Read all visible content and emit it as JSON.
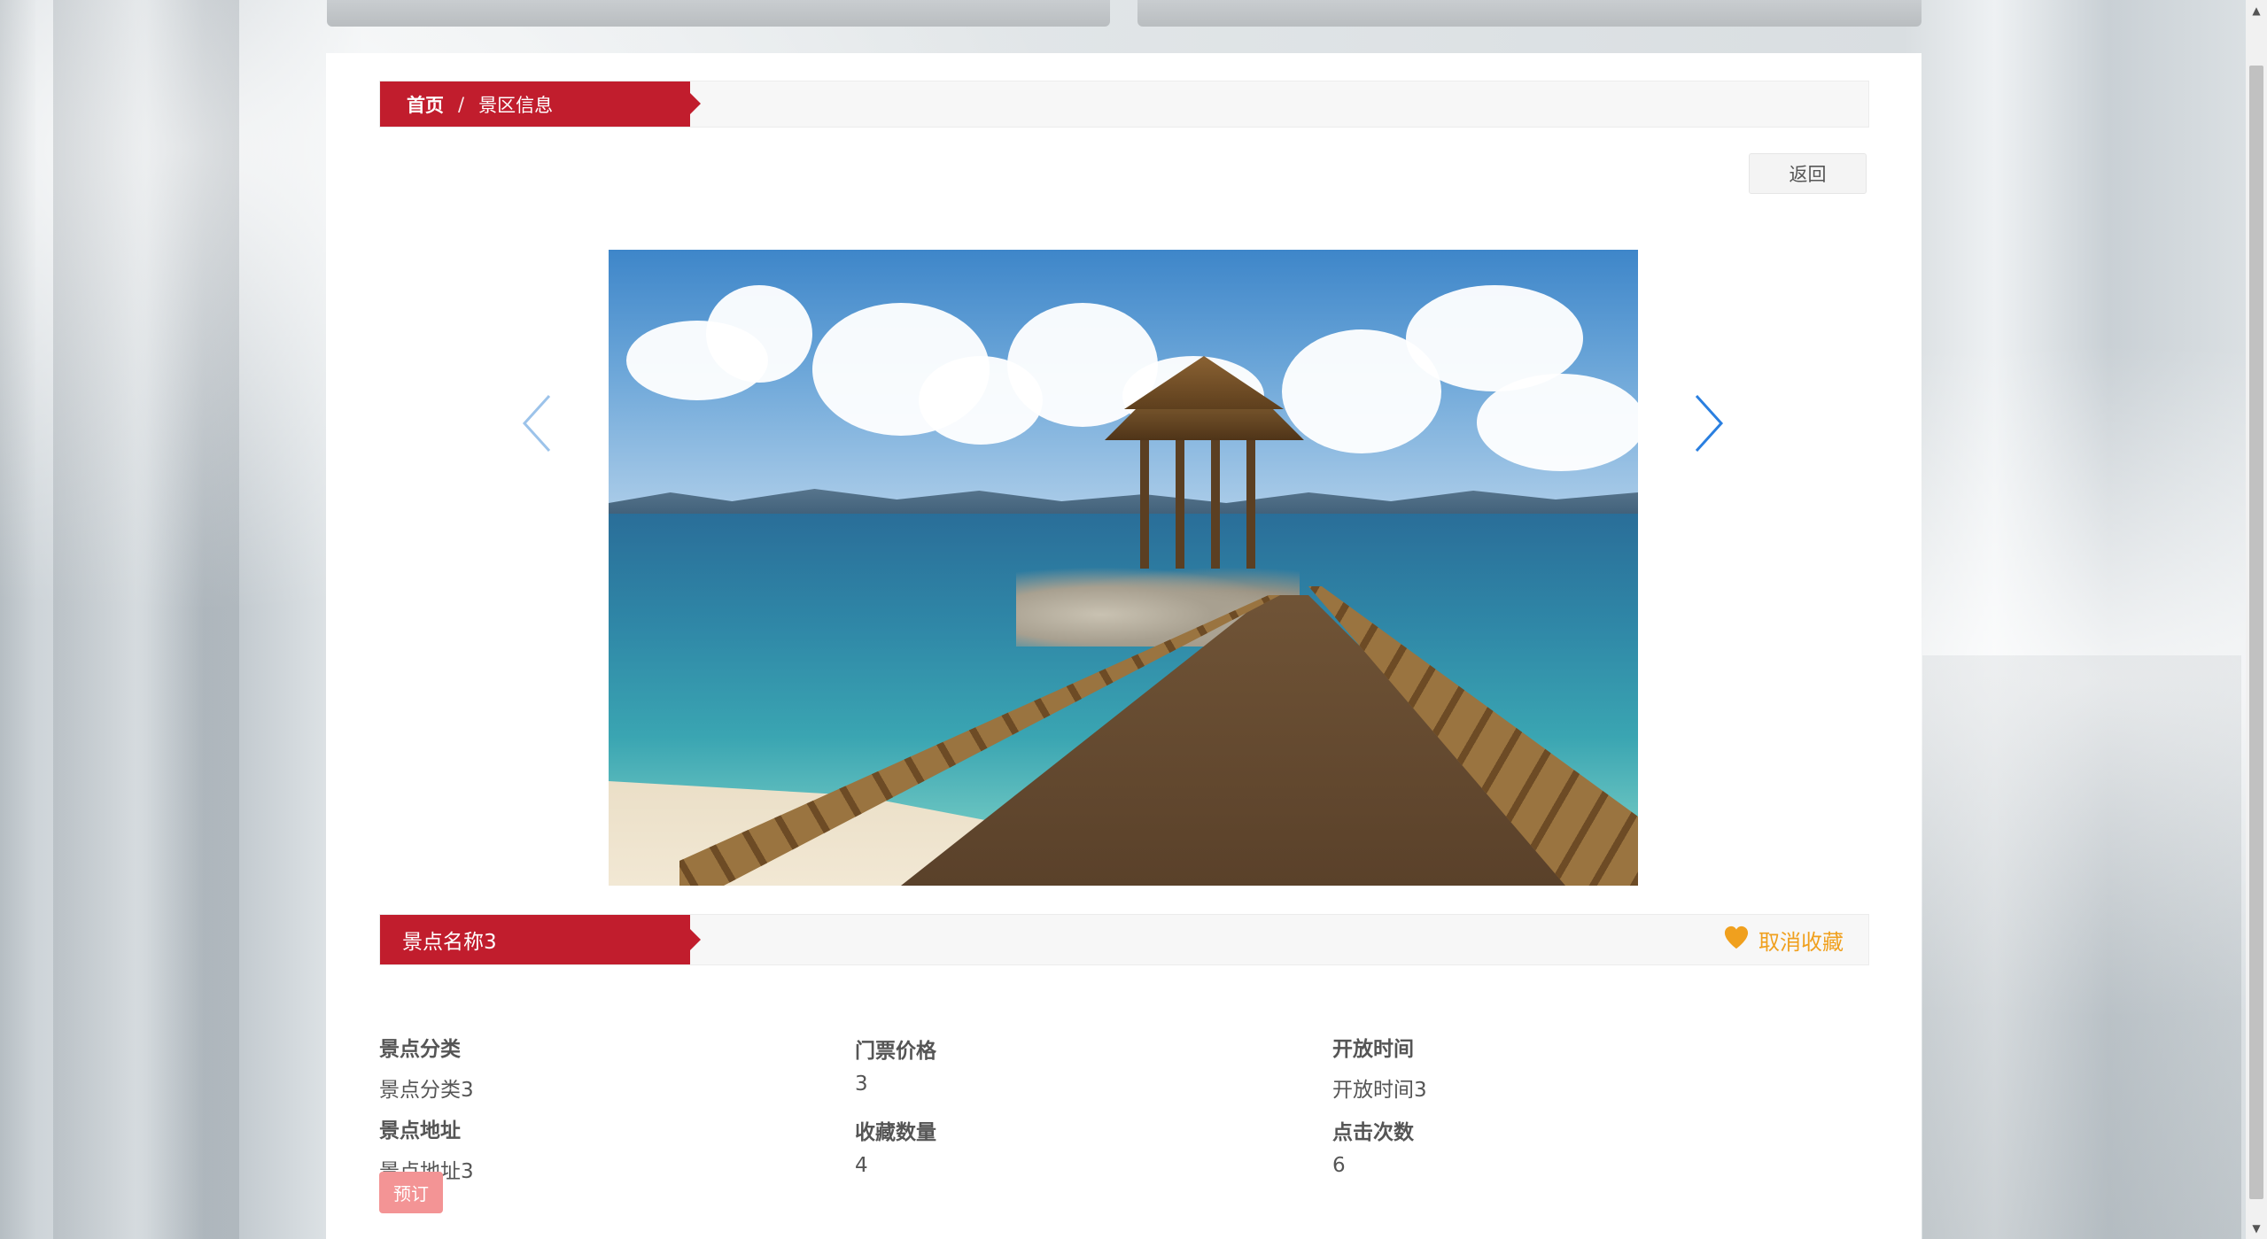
{
  "breadcrumb": {
    "home": "首页",
    "separator": "/",
    "current": "景区信息"
  },
  "actions": {
    "back_label": "返回",
    "book_label": "预订",
    "favorite_label": "取消收藏"
  },
  "attraction": {
    "name": "景点名称3"
  },
  "details": {
    "category_label": "景点分类",
    "category_value": "景点分类3",
    "price_label": "门票价格",
    "price_value": "3",
    "open_time_label": "开放时间",
    "open_time_value": "开放时间3",
    "address_label": "景点地址",
    "address_value": "景点地址3",
    "favorites_label": "收藏数量",
    "favorites_value": "4",
    "clicks_label": "点击次数",
    "clicks_value": "6"
  },
  "carousel": {
    "active_index": 0,
    "image_subject": "seaside pavilion pier photo"
  },
  "colors": {
    "accent_red": "#c11d2d",
    "favorite_orange": "#f0a01e",
    "book_button": "#f39495",
    "arrow_blue": "#2a7fe0"
  },
  "icons": {
    "prev": "chevron-left-icon",
    "next": "chevron-right-icon",
    "favorite": "heart-icon"
  }
}
